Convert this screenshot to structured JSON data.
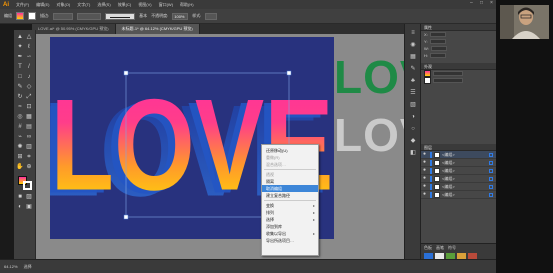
{
  "app": {
    "logo": "Ai",
    "menu": [
      "文件(F)",
      "编辑(E)",
      "对象(O)",
      "文字(T)",
      "选择(S)",
      "效果(C)",
      "视图(V)",
      "窗口(W)",
      "帮助(H)"
    ],
    "window_controls": [
      "minimize-icon",
      "maximize-icon",
      "close-icon"
    ]
  },
  "control_bar": {
    "object_type": "编组",
    "stroke_label": "描边:",
    "style_label": "基本",
    "opacity_label": "不透明度:",
    "opacity_value": "100%",
    "style_word": "样式:"
  },
  "tabs": [
    {
      "label": "LOVE.ai* @ 50.95% (CMYK/GPU 预览)",
      "active": false
    },
    {
      "label": "未标题-1* @ 64.12% (CMYK/GPU 预览)",
      "active": true
    }
  ],
  "artwork": {
    "main_text": "LOVE",
    "side_text_green": "LOVE",
    "side_text_white": "LOVE",
    "colors": {
      "artboard": "#28327e",
      "gradient_top": "#ff2fa0",
      "gradient_bottom": "#ffd400",
      "green_text": "#1f8a46",
      "white_text": "#ffffff"
    }
  },
  "context_menu": {
    "items": [
      {
        "label": "还原移动(U)",
        "dim": false
      },
      {
        "label": "重做(R)",
        "dim": true
      },
      {
        "label": "混合选项…",
        "dim": true
      },
      {
        "separator": true
      },
      {
        "label": "透视",
        "dim": true
      },
      {
        "label": "隔离",
        "dim": false
      },
      {
        "label": "取消编组",
        "dim": false,
        "highlighted": true
      },
      {
        "label": "建立复合路径",
        "dim": false
      },
      {
        "separator": true
      },
      {
        "label": "变换",
        "dim": false,
        "submenu": true
      },
      {
        "label": "排列",
        "dim": false,
        "submenu": true
      },
      {
        "label": "选择",
        "dim": false,
        "submenu": true
      },
      {
        "label": "添加到库",
        "dim": false
      },
      {
        "label": "收集以导出",
        "dim": false,
        "submenu": true
      },
      {
        "label": "导出所选项目…",
        "dim": false
      }
    ]
  },
  "right_panel": {
    "header": "属性",
    "transform_rows": [
      "X:",
      "Y:",
      "W:",
      "H:"
    ],
    "appearance_label": "外观",
    "layers_header": "图层",
    "layers": [
      {
        "name": "<编组>",
        "selected": true
      },
      {
        "name": "<编组>",
        "selected": false
      },
      {
        "name": "<编组>",
        "selected": false
      },
      {
        "name": "<编组>",
        "selected": false
      },
      {
        "name": "<编组>",
        "selected": false
      },
      {
        "name": "<编组>",
        "selected": false
      }
    ],
    "bottom_tabs": [
      "色板",
      "画笔",
      "符号"
    ]
  },
  "status_bar": {
    "zoom": "64.12%",
    "tool": "选择"
  }
}
